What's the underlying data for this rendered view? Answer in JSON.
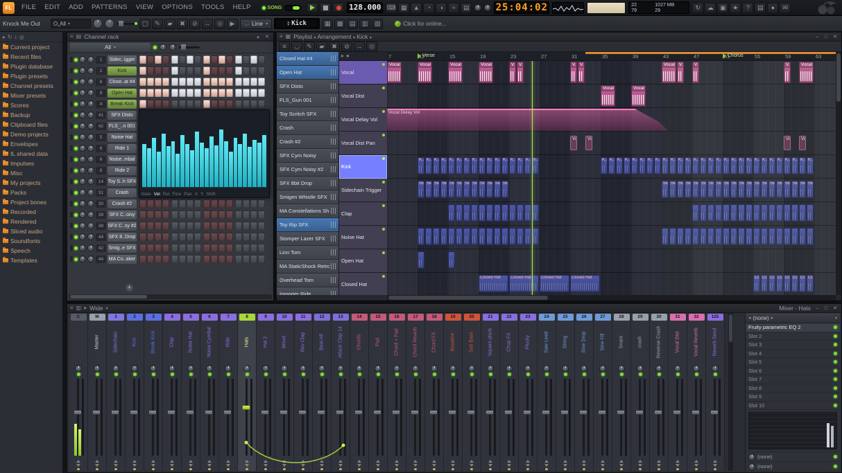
{
  "menubar": {
    "menus": [
      "FILE",
      "EDIT",
      "ADD",
      "PATTERNS",
      "VIEW",
      "OPTIONS",
      "TOOLS",
      "HELP"
    ],
    "song_label": "SONG",
    "tempo": "128.000",
    "time": "25:04:02",
    "stats": {
      "cpu": "22",
      "mem": "1027 MB",
      "row2_a": "79",
      "row2_b": "29"
    }
  },
  "toolbar": {
    "project_title": "Knock Me Out",
    "search_value": "All",
    "snap_mode": "Line",
    "pattern_name": "Kick",
    "online_hint": "Click for online..."
  },
  "icon_groups": {
    "menubar_small": [
      "typing-keyboard-icon",
      "midi-keyboard-icon",
      "metronome-icon",
      "precount-icon",
      "wait-icon",
      "blend-notes-icon",
      "step-edit-icon"
    ],
    "menubar_right": [
      "sync-icon",
      "online-icon",
      "gift-icon",
      "trophy-icon",
      "help-icon",
      "news-icon",
      "alerts-icon",
      "chat-icon"
    ],
    "toolbar_tools": [
      "select-tool-icon",
      "draw-tool-icon",
      "paint-tool-icon",
      "delete-tool-icon",
      "mute-tool-icon",
      "slip-tool-icon",
      "zoom-tool-icon",
      "playback-tool-icon"
    ],
    "toolbar_windows": [
      "playlist-window-icon",
      "piano-roll-window-icon",
      "channel-rack-window-icon",
      "mixer-window-icon",
      "browser-window-icon"
    ],
    "playlist_tools": [
      "menu-icon",
      "magnet-icon",
      "draw-tool-icon",
      "paint-tool-icon",
      "delete-tool-icon",
      "mute-tool-icon",
      "slip-tool-icon",
      "zoom-tool-icon"
    ],
    "browser_tools": [
      "collapse-icon",
      "refresh-icon",
      "sort-icon",
      "find-icon"
    ]
  },
  "browser": {
    "items": [
      "Current project",
      "Recent files",
      "Plugin database",
      "Plugin presets",
      "Channel presets",
      "Mixer presets",
      "Scores",
      "Backup",
      "Clipboard files",
      "Demo projects",
      "Envelopes",
      "IL shared data",
      "Impulses",
      "Misc",
      "My projects",
      "Packs",
      "Project bones",
      "Recorded",
      "Rendered",
      "Sliced audio",
      "Soundfonts",
      "Speech",
      "Templates"
    ]
  },
  "channel_rack": {
    "title": "Channel rack",
    "filter_label": "All",
    "add_label": "+",
    "channels": [
      {
        "num": "1",
        "name": "Sidec..igger",
        "sel": false,
        "steps": "1010101010101010"
      },
      {
        "num": "2",
        "name": "Kick",
        "sel": true,
        "steps": "1000100010001000"
      },
      {
        "num": "8",
        "name": "Close..at #4",
        "sel": false,
        "steps": "1111111111111111"
      },
      {
        "num": "9",
        "name": "Open Hat",
        "sel": true,
        "steps": "1111111111111111"
      },
      {
        "num": "4",
        "name": "Break Kick",
        "sel": true,
        "steps": "1000000010000000"
      },
      {
        "num": "41",
        "name": "SFX Disto",
        "sel": false,
        "steps": "0000000000000000"
      },
      {
        "num": "42",
        "name": "FLS_..n 001",
        "sel": false,
        "steps": "0000000000000000"
      },
      {
        "num": "5",
        "name": "Noise Hat",
        "sel": false,
        "steps": "0000000000000000"
      },
      {
        "num": "6",
        "name": "Ride 1",
        "sel": false,
        "steps": "0000000000000000"
      },
      {
        "num": "6",
        "name": "Noise..mbal",
        "sel": false,
        "steps": "0000000000000000"
      },
      {
        "num": "8",
        "name": "Ride 2",
        "sel": false,
        "steps": "0000000000000000"
      },
      {
        "num": "14",
        "name": "Toy S..h SFX",
        "sel": false,
        "steps": "0000000000000000"
      },
      {
        "num": "31",
        "name": "Crash",
        "sel": false,
        "steps": "0000000000000000"
      },
      {
        "num": "30",
        "name": "Crash #2",
        "sel": false,
        "steps": "0000000000000000"
      },
      {
        "num": "39",
        "name": "SFX C..oisy",
        "sel": false,
        "steps": "0000000000000000"
      },
      {
        "num": "38",
        "name": "SFX C..sy #2",
        "sel": false,
        "steps": "0000000000000000"
      },
      {
        "num": "44",
        "name": "SFX 8..Drop",
        "sel": false,
        "steps": "0000000000000000"
      },
      {
        "num": "42",
        "name": "Smig..e SFX",
        "sel": false,
        "steps": "0000000000000000"
      },
      {
        "num": "44",
        "name": "MA Co..aker",
        "sel": false,
        "steps": "0000000000000000"
      }
    ],
    "graph": {
      "values": [
        58,
        52,
        66,
        48,
        72,
        55,
        62,
        45,
        70,
        58,
        50,
        75,
        60,
        52,
        68,
        56,
        78,
        62,
        48,
        66,
        58,
        72,
        54,
        64,
        60,
        70
      ],
      "tabs": [
        "Note",
        "Vel",
        "Rel",
        "Fine",
        "Pan",
        "X",
        "Y",
        "Shift"
      ],
      "active_tab": "Vel"
    }
  },
  "playlist": {
    "title_parts": [
      "Playlist",
      "Arrangement",
      "Kick"
    ],
    "picker": [
      {
        "name": "Closed Hat #4",
        "sel": true
      },
      {
        "name": "Open Hat",
        "sel": true
      },
      {
        "name": "SFX Disto",
        "sel": false
      },
      {
        "name": "FLS_Gun 001",
        "sel": false
      },
      {
        "name": "Toy Scritch SFX",
        "sel": false
      },
      {
        "name": "Crash",
        "sel": false
      },
      {
        "name": "Crash #2",
        "sel": false
      },
      {
        "name": "SFX Cym Noisy",
        "sel": false
      },
      {
        "name": "SFX Cym Noisy #2",
        "sel": false
      },
      {
        "name": "SFX 8bit Drop",
        "sel": false
      },
      {
        "name": "Smigen Whistle SFX",
        "sel": false
      },
      {
        "name": "MA Constellations Sh..",
        "sel": false
      },
      {
        "name": "Toy Rip SFX",
        "sel": true
      },
      {
        "name": "Stomper Lazer SFX",
        "sel": false
      },
      {
        "name": "Linn Tom",
        "sel": false
      },
      {
        "name": "MA StaticShock Retro..",
        "sel": false
      },
      {
        "name": "Overhead Tom",
        "sel": false
      },
      {
        "name": "Importer Ride",
        "sel": false
      }
    ],
    "ruler_numbers": [
      "7",
      "11",
      "15",
      "19",
      "23",
      "27",
      "31",
      "35",
      "39",
      "43",
      "47",
      "51",
      "55",
      "59",
      "63"
    ],
    "markers": [
      {
        "bar": 11,
        "label": "Verse"
      },
      {
        "bar": 51,
        "label": "Chorus"
      }
    ],
    "playhead_bar": 26,
    "selection_start_bar": 33,
    "tracks": [
      {
        "name": "Vocal",
        "color": "#6a5ab0",
        "sel": false,
        "clips": [
          {
            "b": 7,
            "w": 2,
            "l": "Vocal",
            "t": "audio"
          },
          {
            "b": 11,
            "w": 2,
            "l": "Vocal",
            "t": "audio"
          },
          {
            "b": 15,
            "w": 2,
            "l": "Vocal",
            "t": "audio"
          },
          {
            "b": 19,
            "w": 2,
            "l": "Vocal",
            "t": "audio"
          },
          {
            "b": 23,
            "w": 1,
            "l": "V..l",
            "t": "audio"
          },
          {
            "b": 24,
            "w": 1,
            "l": "V..l",
            "t": "audio"
          },
          {
            "b": 31,
            "w": 1,
            "l": "V..l",
            "t": "audio"
          },
          {
            "b": 32,
            "w": 1,
            "l": "V..l",
            "t": "audio"
          },
          {
            "b": 43,
            "w": 2,
            "l": "Vocal",
            "t": "audio"
          },
          {
            "b": 45,
            "w": 1,
            "l": "V..l",
            "t": "audio"
          },
          {
            "b": 47,
            "w": 1,
            "l": "V..l",
            "t": "audio"
          },
          {
            "b": 59,
            "w": 1,
            "l": "V..l",
            "t": "audio"
          },
          {
            "b": 61,
            "w": 2,
            "l": "Vocal",
            "t": "audio"
          }
        ]
      },
      {
        "name": "Vocal Dist",
        "color": "#433f52",
        "sel": false,
        "clips": [
          {
            "b": 35,
            "w": 2,
            "l": "Vocal",
            "t": "audio"
          },
          {
            "b": 39,
            "w": 2,
            "l": "Vocal",
            "t": "audio"
          }
        ]
      },
      {
        "name": "Vocal Delay Vol",
        "color": "#433f52",
        "sel": false,
        "clips": [
          {
            "b": 7,
            "w": 37,
            "l": "Vocal Delay Vol",
            "t": "auto"
          }
        ]
      },
      {
        "name": "Vocal Dist Pan",
        "color": "#433f52",
        "sel": false,
        "clips": [
          {
            "b": 31,
            "w": 1,
            "l": "Vo..n",
            "t": "auto2"
          },
          {
            "b": 33,
            "w": 1,
            "l": "Vo..n",
            "t": "auto2"
          },
          {
            "b": 59,
            "w": 1,
            "l": "Vo..n",
            "t": "auto2"
          },
          {
            "b": 61,
            "w": 1,
            "l": "Vo..n",
            "t": "auto2"
          }
        ]
      },
      {
        "name": "Kick",
        "color": "#5a62d0",
        "sel": true,
        "clips": [
          {
            "b": 11,
            "w": 1,
            "l": "K..2",
            "t": "pat",
            "rpt": 16
          },
          {
            "b": 35,
            "w": 1,
            "l": "K..2",
            "t": "pat",
            "rpt": 28
          }
        ]
      },
      {
        "name": "Sidechain Trigger",
        "color": "#433f52",
        "sel": false,
        "clips": [
          {
            "b": 11,
            "w": 1,
            "l": "Sid..2",
            "t": "pat",
            "rpt": 12
          },
          {
            "b": 43,
            "w": 1,
            "l": "Sid..2",
            "t": "pat",
            "rpt": 20
          }
        ]
      },
      {
        "name": "Clap",
        "color": "#433f52",
        "sel": false,
        "clips": [
          {
            "b": 15,
            "w": 1,
            "l": "",
            "t": "pat",
            "rpt": 12
          },
          {
            "b": 47,
            "w": 1,
            "l": "",
            "t": "pat",
            "rpt": 16
          }
        ]
      },
      {
        "name": "Noise Hat",
        "color": "#433f52",
        "sel": false,
        "clips": [
          {
            "b": 11,
            "w": 1,
            "l": "",
            "t": "pat",
            "rpt": 16
          },
          {
            "b": 43,
            "w": 1,
            "l": "",
            "t": "pat",
            "rpt": 20
          }
        ]
      },
      {
        "name": "Open Hat",
        "color": "#433f52",
        "sel": false,
        "clips": [
          {
            "b": 11,
            "w": 1,
            "l": "",
            "t": "pat"
          },
          {
            "b": 15,
            "w": 1,
            "l": "",
            "t": "pat"
          }
        ]
      },
      {
        "name": "Closed Hat",
        "color": "#433f52",
        "sel": false,
        "clips": [
          {
            "b": 19,
            "w": 4,
            "l": "Closed Hat",
            "t": "pat"
          },
          {
            "b": 23,
            "w": 4,
            "l": "Closed Hat",
            "t": "pat"
          },
          {
            "b": 27,
            "w": 4,
            "l": "Closed Hat",
            "t": "pat"
          },
          {
            "b": 31,
            "w": 4,
            "l": "Closed Hat",
            "t": "pat"
          },
          {
            "b": 55,
            "w": 1,
            "l": "Cl..3",
            "t": "pat",
            "rpt": 8
          }
        ]
      }
    ]
  },
  "mixer": {
    "title": "Mixer - Hats",
    "layout_mode": "Wide",
    "strips": [
      {
        "num": "C",
        "name": "",
        "color": "#565a64",
        "sel": false,
        "meter": true
      },
      {
        "num": "M",
        "name": "Master",
        "color": "#9aa0ab",
        "sel": false
      },
      {
        "num": "1",
        "name": "Sidechain",
        "color": "#8076e0",
        "sel": false
      },
      {
        "num": "2",
        "name": "Kick",
        "color": "#5c6fe0",
        "sel": false
      },
      {
        "num": "3",
        "name": "Break Kick",
        "color": "#5c6fe0",
        "sel": false
      },
      {
        "num": "4",
        "name": "Clap",
        "color": "#8a6ee0",
        "sel": false
      },
      {
        "num": "5",
        "name": "Noise Hat",
        "color": "#8a6ee0",
        "sel": false
      },
      {
        "num": "6",
        "name": "Noise Cymbal",
        "color": "#8a6ee0",
        "sel": false
      },
      {
        "num": "7",
        "name": "Ride",
        "color": "#8a6ee0",
        "sel": false
      },
      {
        "num": "8",
        "name": "Hats",
        "color": "#a8d838",
        "sel": true
      },
      {
        "num": "9",
        "name": "Hat 2",
        "color": "#8a6ee0",
        "sel": false
      },
      {
        "num": "10",
        "name": "Wood",
        "color": "#8a6ee0",
        "sel": false
      },
      {
        "num": "11",
        "name": "Rev Clap",
        "color": "#8a6ee0",
        "sel": false
      },
      {
        "num": "12",
        "name": "Beat All",
        "color": "#7d6ed8",
        "sel": false
      },
      {
        "num": "13",
        "name": "Attack Clap 14",
        "color": "#7d6ed8",
        "sel": false
      },
      {
        "num": "14",
        "name": "Chords",
        "color": "#c25a78",
        "sel": false
      },
      {
        "num": "15",
        "name": "Pad",
        "color": "#c25a78",
        "sel": false
      },
      {
        "num": "16",
        "name": "Chord + Pad",
        "color": "#c25a78",
        "sel": false
      },
      {
        "num": "17",
        "name": "Chord Reverb",
        "color": "#c25a78",
        "sel": false
      },
      {
        "num": "18",
        "name": "Chord FX",
        "color": "#c25a78",
        "sel": false
      },
      {
        "num": "19",
        "name": "Bassline",
        "color": "#d0543a",
        "sel": false
      },
      {
        "num": "20",
        "name": "Sub Bass",
        "color": "#d0543a",
        "sel": false
      },
      {
        "num": "21",
        "name": "Square pluck",
        "color": "#8a6ee0",
        "sel": false
      },
      {
        "num": "22",
        "name": "Chop FX",
        "color": "#8a6ee0",
        "sel": false
      },
      {
        "num": "23",
        "name": "Plucky",
        "color": "#8a6ee0",
        "sel": false
      },
      {
        "num": "24",
        "name": "Saw Lead",
        "color": "#6f9ad8",
        "sel": false
      },
      {
        "num": "25",
        "name": "String",
        "color": "#6f9ad8",
        "sel": false
      },
      {
        "num": "26",
        "name": "Sine Drop",
        "color": "#6f9ad8",
        "sel": false
      },
      {
        "num": "27",
        "name": "Sine Fill",
        "color": "#6f9ad8",
        "sel": false
      },
      {
        "num": "28",
        "name": "Snare",
        "color": "#9aa0ab",
        "sel": false
      },
      {
        "num": "29",
        "name": "crash",
        "color": "#9aa0ab",
        "sel": false
      },
      {
        "num": "30",
        "name": "Reverse Crash",
        "color": "#9aa0ab",
        "sel": false
      },
      {
        "num": "31",
        "name": "Vocal Dist",
        "color": "#d86fb0",
        "sel": false
      },
      {
        "num": "32",
        "name": "Vocal Reverb",
        "color": "#d86fb0",
        "sel": false
      },
      {
        "num": "125",
        "name": "Reverb Send",
        "color": "#8a6ee0",
        "sel": false
      }
    ],
    "fx": {
      "preset_label": "(none)",
      "slots": [
        {
          "name": "Fruity parametric EQ 2",
          "active": true
        },
        {
          "name": "Slot 2",
          "active": false
        },
        {
          "name": "Slot 3",
          "active": false
        },
        {
          "name": "Slot 4",
          "active": false
        },
        {
          "name": "Slot 5",
          "active": false
        },
        {
          "name": "Slot 6",
          "active": false
        },
        {
          "name": "Slot 7",
          "active": false
        },
        {
          "name": "Slot 8",
          "active": false
        },
        {
          "name": "Slot 9",
          "active": false
        },
        {
          "name": "Slot 10",
          "active": false
        }
      ],
      "sends": [
        "(none)",
        "(none)"
      ]
    }
  }
}
